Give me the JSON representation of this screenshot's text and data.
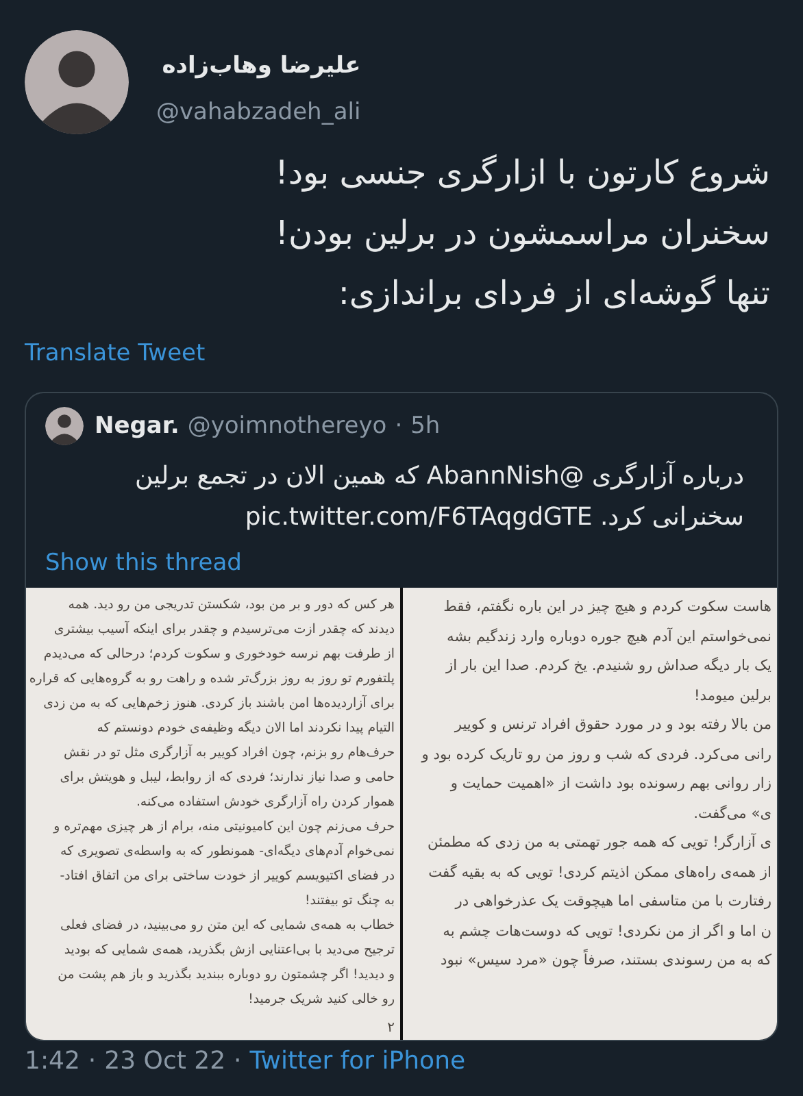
{
  "tweet": {
    "author_name": "علیرضا وهاب‌زاده",
    "handle": "@vahabzadeh_ali",
    "text_lines": [
      "شروع کارتون با ازارگری جنسی بود!",
      "سخنران مراسمشون در برلین بودن!",
      "تنها گوشه‌ای از فردای براندازی:"
    ],
    "translate_link": "Translate Tweet"
  },
  "quoted_tweet": {
    "author_name": "Negar.",
    "handle": "@yoimnothereyo",
    "separator": "·",
    "time": "5h",
    "text_lines": [
      "درباره آزارگری @AbannNish که همین الان در تجمع برلین",
      "سخنرانی کرد. pic.twitter.com/F6TAqgdGTE"
    ],
    "show_thread": "Show this thread",
    "images": [
      {
        "lines": [
          "هاست سکوت کردم و هیچ چیز در این باره نگفتم، فقط",
          "نمی‌خواستم این آدم هیچ جوره دوباره وارد زندگیم بشه",
          "یک بار دیگه صداش رو شنیدم. یخ کردم. صدا این بار از",
          "برلین میومد!",
          "من بالا رفته بود و در مورد حقوق افراد ترنس و کوییر",
          "رانی می‌کرد. فردی که شب و روز من رو تاریک کرده بود و",
          "زار روانی بهم رسونده بود داشت از «اهمیت حمایت و",
          "ی» می‌گفت.",
          "ی آزارگر! تویی که همه جور تهمتی به من زدی که مطمئن",
          "از همه‌ی راه‌های ممکن اذیتم کردی! تویی که به بقیه گفت",
          "رفتارت با من متاسفی اما هیچوقت یک عذرخواهی در",
          "ن اما و اگر از من نکردی! تویی که دوست‌هات چشم به",
          "که به من رسوندی بستند، صرفاً چون «مرد سیس» نبود"
        ]
      },
      {
        "lines": [
          "هر کس که دور و بر من بود، شکستن تدریجی من رو دید. همه",
          "دیدند که چقدر ازت می‌ترسیدم و چقدر برای اینکه آسیب بیشتری",
          "از طرفت بهم نرسه خودخوری و سکوت کردم؛ درحالی که می‌دیدم",
          "پلتفورم تو روز به روز بزرگ‌تر شده و راهت رو به گروه‌هایی که قراره",
          "برای آزاردیده‌ها امن باشند باز کردی. هنوز زخم‌هایی که به من زدی",
          "التیام پیدا نکردند اما الان دیگه وظیفه‌ی خودم دونستم که",
          "حرف‌هام رو بزنم، چون افراد کوییر به آزارگری مثل تو در نقش",
          "حامی و صدا نیاز ندارند؛ فردی که از روابط، لیبل و هویتش برای",
          "هموار کردن راه آزارگری خودش استفاده می‌کنه.",
          "حرف می‌زنم چون این کامیونیتی منه، برام از هر چیزی مهم‌تره و",
          "نمی‌خوام آدم‌های دیگه‌ای- همونطور که به واسطه‌ی تصویری که",
          "در فضای اکتیویسم کوییر از خودت ساختی برای من اتفاق افتاد-",
          "به چنگ تو بیفتند!",
          "خطاب به همه‌ی شمایی که این متن رو می‌بینید، در فضای فعلی",
          "ترجیح می‌دید با بی‌اعتنایی ازش بگذرید، همه‌ی شمایی که بودید",
          "و دیدید! اگر چشمتون رو دوباره ببندید بگذرید و باز هم پشت من",
          "رو خالی کنید شریک جرمید!"
        ],
        "page_number": "۲"
      }
    ]
  },
  "footer": {
    "time": "1:42",
    "separator": "·",
    "date": "23 Oct 22",
    "separator_2": "·",
    "source": "Twitter for iPhone"
  }
}
